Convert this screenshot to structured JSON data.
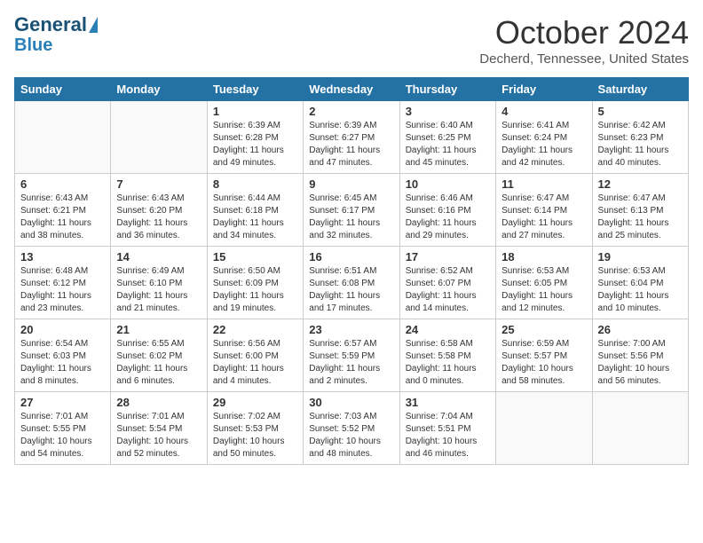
{
  "logo": {
    "line1": "General",
    "line2": "Blue"
  },
  "title": "October 2024",
  "location": "Decherd, Tennessee, United States",
  "days_of_week": [
    "Sunday",
    "Monday",
    "Tuesday",
    "Wednesday",
    "Thursday",
    "Friday",
    "Saturday"
  ],
  "weeks": [
    [
      {
        "day": "",
        "info": ""
      },
      {
        "day": "",
        "info": ""
      },
      {
        "day": "1",
        "info": "Sunrise: 6:39 AM\nSunset: 6:28 PM\nDaylight: 11 hours and 49 minutes."
      },
      {
        "day": "2",
        "info": "Sunrise: 6:39 AM\nSunset: 6:27 PM\nDaylight: 11 hours and 47 minutes."
      },
      {
        "day": "3",
        "info": "Sunrise: 6:40 AM\nSunset: 6:25 PM\nDaylight: 11 hours and 45 minutes."
      },
      {
        "day": "4",
        "info": "Sunrise: 6:41 AM\nSunset: 6:24 PM\nDaylight: 11 hours and 42 minutes."
      },
      {
        "day": "5",
        "info": "Sunrise: 6:42 AM\nSunset: 6:23 PM\nDaylight: 11 hours and 40 minutes."
      }
    ],
    [
      {
        "day": "6",
        "info": "Sunrise: 6:43 AM\nSunset: 6:21 PM\nDaylight: 11 hours and 38 minutes."
      },
      {
        "day": "7",
        "info": "Sunrise: 6:43 AM\nSunset: 6:20 PM\nDaylight: 11 hours and 36 minutes."
      },
      {
        "day": "8",
        "info": "Sunrise: 6:44 AM\nSunset: 6:18 PM\nDaylight: 11 hours and 34 minutes."
      },
      {
        "day": "9",
        "info": "Sunrise: 6:45 AM\nSunset: 6:17 PM\nDaylight: 11 hours and 32 minutes."
      },
      {
        "day": "10",
        "info": "Sunrise: 6:46 AM\nSunset: 6:16 PM\nDaylight: 11 hours and 29 minutes."
      },
      {
        "day": "11",
        "info": "Sunrise: 6:47 AM\nSunset: 6:14 PM\nDaylight: 11 hours and 27 minutes."
      },
      {
        "day": "12",
        "info": "Sunrise: 6:47 AM\nSunset: 6:13 PM\nDaylight: 11 hours and 25 minutes."
      }
    ],
    [
      {
        "day": "13",
        "info": "Sunrise: 6:48 AM\nSunset: 6:12 PM\nDaylight: 11 hours and 23 minutes."
      },
      {
        "day": "14",
        "info": "Sunrise: 6:49 AM\nSunset: 6:10 PM\nDaylight: 11 hours and 21 minutes."
      },
      {
        "day": "15",
        "info": "Sunrise: 6:50 AM\nSunset: 6:09 PM\nDaylight: 11 hours and 19 minutes."
      },
      {
        "day": "16",
        "info": "Sunrise: 6:51 AM\nSunset: 6:08 PM\nDaylight: 11 hours and 17 minutes."
      },
      {
        "day": "17",
        "info": "Sunrise: 6:52 AM\nSunset: 6:07 PM\nDaylight: 11 hours and 14 minutes."
      },
      {
        "day": "18",
        "info": "Sunrise: 6:53 AM\nSunset: 6:05 PM\nDaylight: 11 hours and 12 minutes."
      },
      {
        "day": "19",
        "info": "Sunrise: 6:53 AM\nSunset: 6:04 PM\nDaylight: 11 hours and 10 minutes."
      }
    ],
    [
      {
        "day": "20",
        "info": "Sunrise: 6:54 AM\nSunset: 6:03 PM\nDaylight: 11 hours and 8 minutes."
      },
      {
        "day": "21",
        "info": "Sunrise: 6:55 AM\nSunset: 6:02 PM\nDaylight: 11 hours and 6 minutes."
      },
      {
        "day": "22",
        "info": "Sunrise: 6:56 AM\nSunset: 6:00 PM\nDaylight: 11 hours and 4 minutes."
      },
      {
        "day": "23",
        "info": "Sunrise: 6:57 AM\nSunset: 5:59 PM\nDaylight: 11 hours and 2 minutes."
      },
      {
        "day": "24",
        "info": "Sunrise: 6:58 AM\nSunset: 5:58 PM\nDaylight: 11 hours and 0 minutes."
      },
      {
        "day": "25",
        "info": "Sunrise: 6:59 AM\nSunset: 5:57 PM\nDaylight: 10 hours and 58 minutes."
      },
      {
        "day": "26",
        "info": "Sunrise: 7:00 AM\nSunset: 5:56 PM\nDaylight: 10 hours and 56 minutes."
      }
    ],
    [
      {
        "day": "27",
        "info": "Sunrise: 7:01 AM\nSunset: 5:55 PM\nDaylight: 10 hours and 54 minutes."
      },
      {
        "day": "28",
        "info": "Sunrise: 7:01 AM\nSunset: 5:54 PM\nDaylight: 10 hours and 52 minutes."
      },
      {
        "day": "29",
        "info": "Sunrise: 7:02 AM\nSunset: 5:53 PM\nDaylight: 10 hours and 50 minutes."
      },
      {
        "day": "30",
        "info": "Sunrise: 7:03 AM\nSunset: 5:52 PM\nDaylight: 10 hours and 48 minutes."
      },
      {
        "day": "31",
        "info": "Sunrise: 7:04 AM\nSunset: 5:51 PM\nDaylight: 10 hours and 46 minutes."
      },
      {
        "day": "",
        "info": ""
      },
      {
        "day": "",
        "info": ""
      }
    ]
  ]
}
